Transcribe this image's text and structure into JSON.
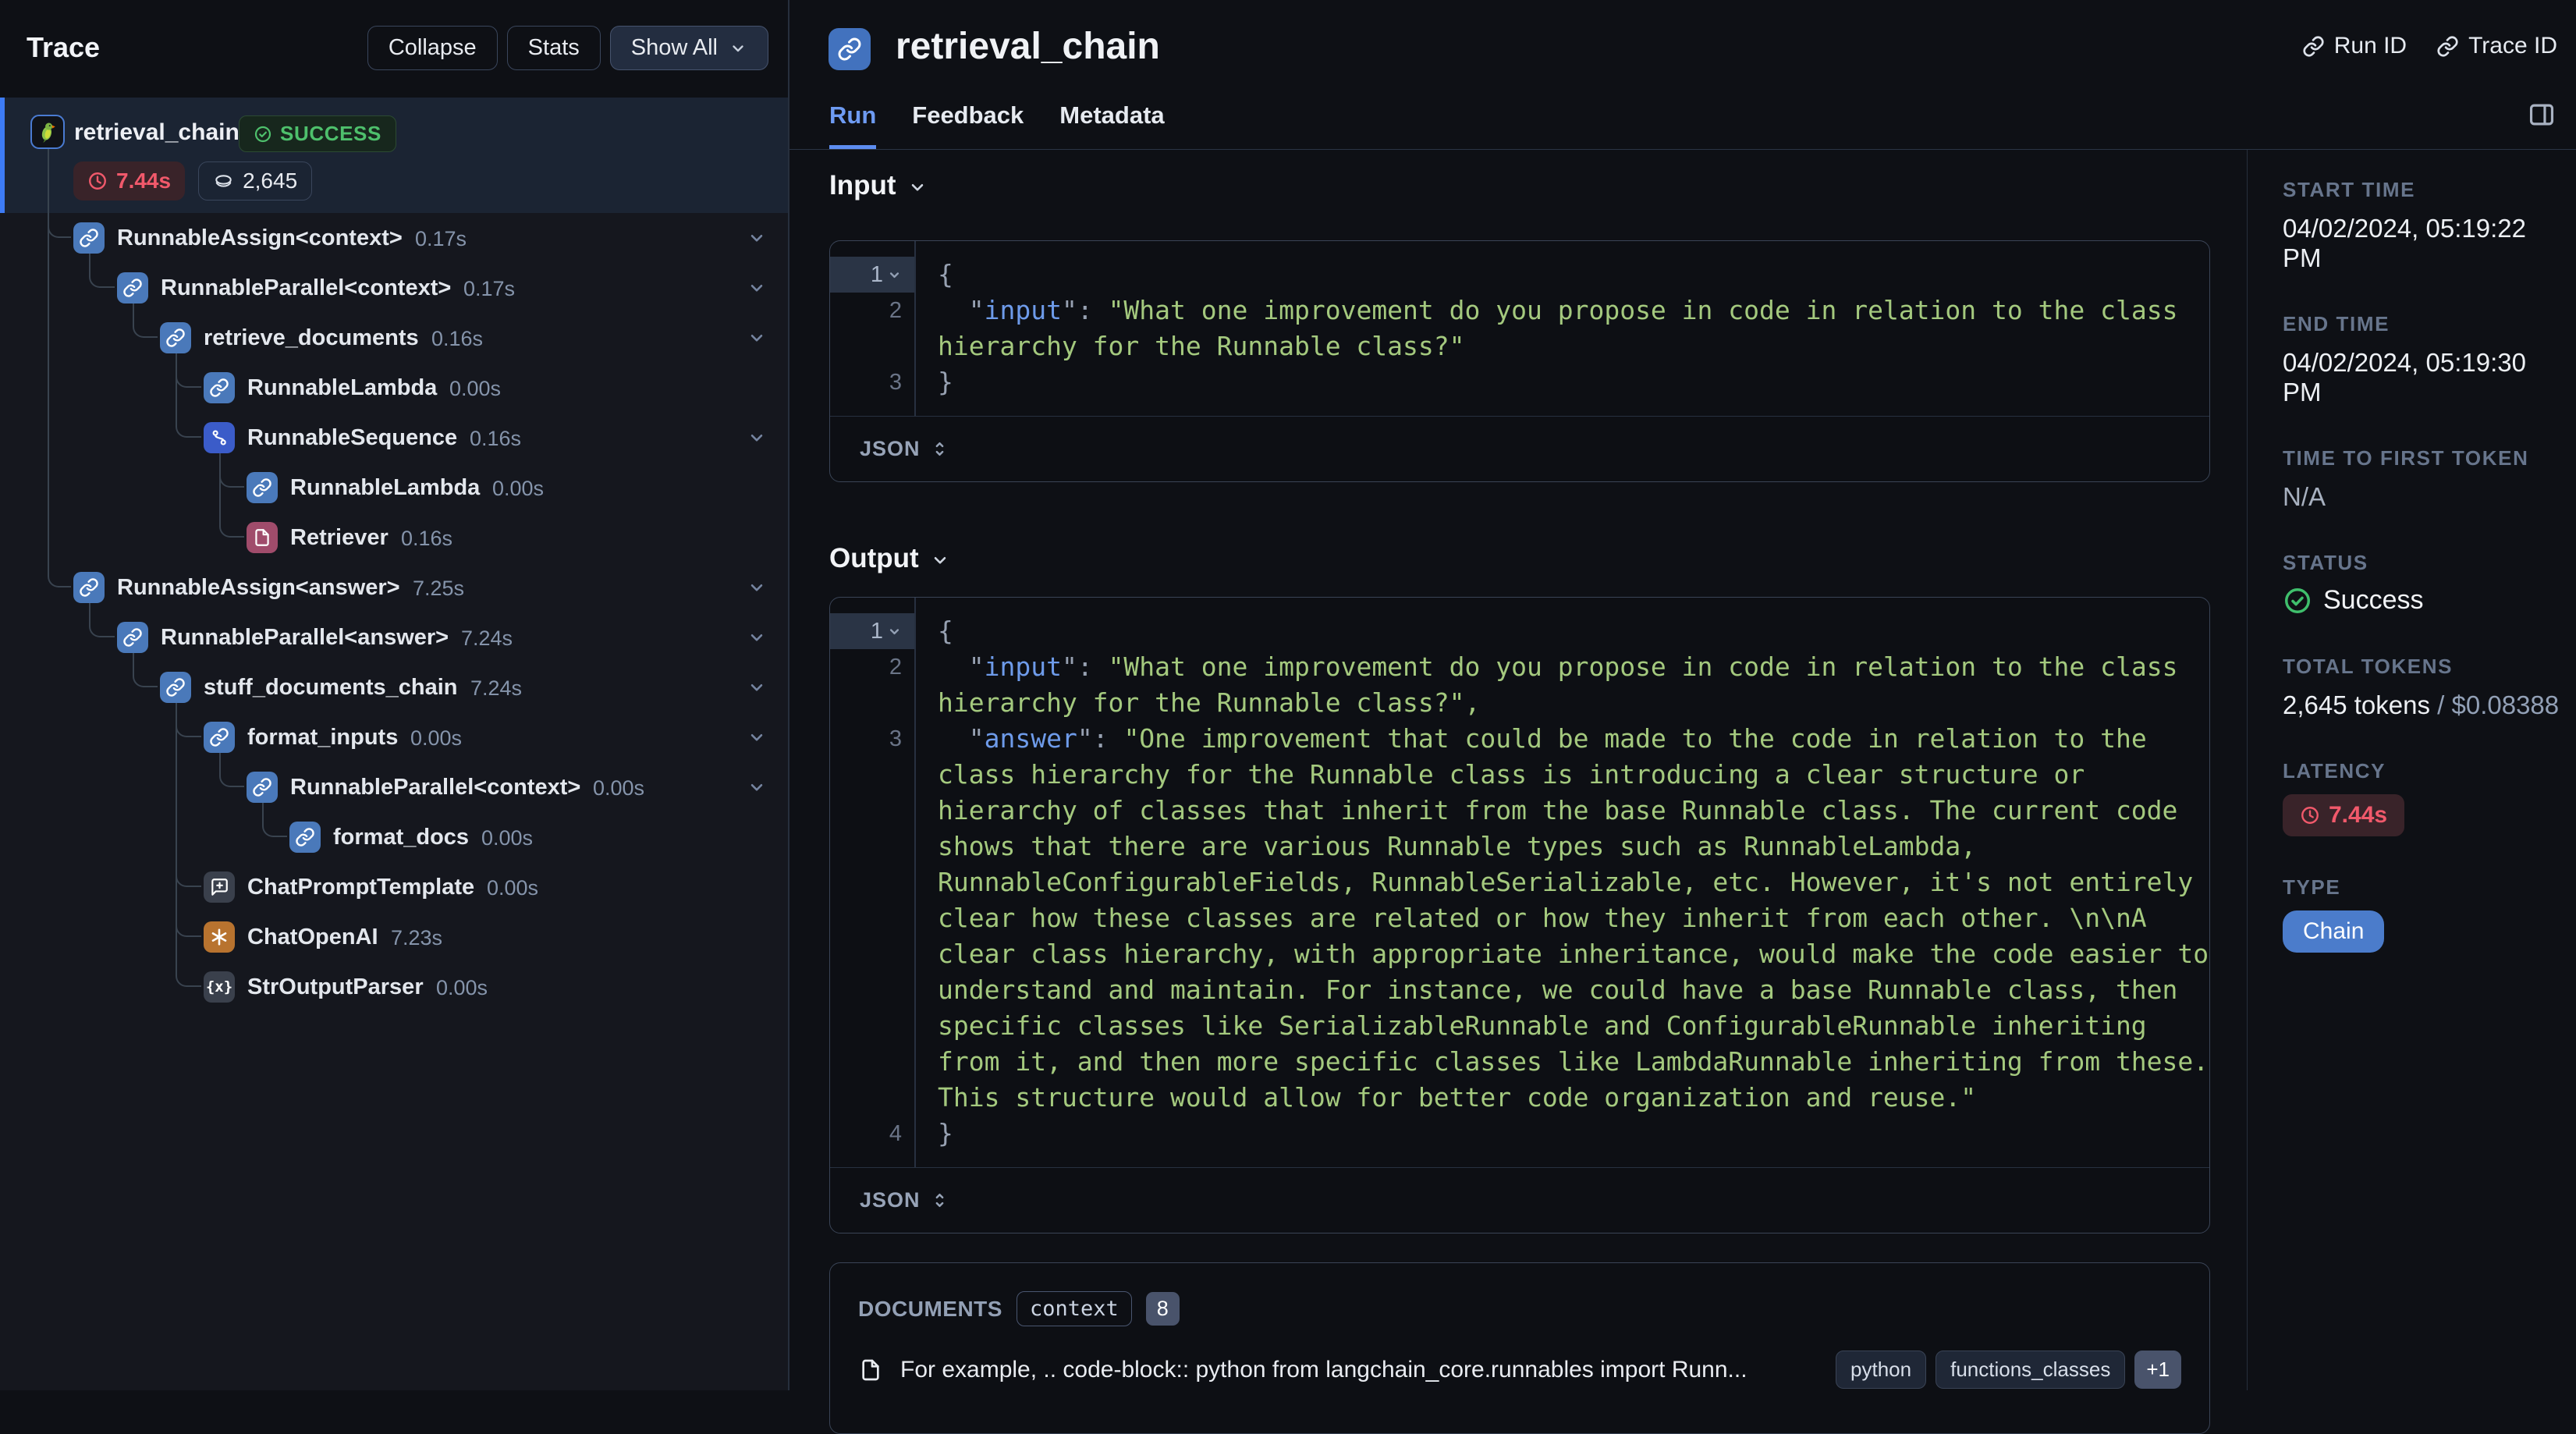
{
  "colors": {
    "accent_blue": "#3D7BF5",
    "success_green": "#4EC06C",
    "error_red": "#F1596B",
    "code_key_blue": "#6E9BEA",
    "code_string_green": "#A4C97E",
    "type_badge_blue": "#4B7CCB",
    "icon_chain_blue": "#4A79BA",
    "icon_sequence_blue": "#3B5CC9",
    "icon_retriever_maroon": "#A04C6B",
    "icon_openai_orange": "#B8732F"
  },
  "sidebar": {
    "title": "Trace",
    "buttons": {
      "collapse": "Collapse",
      "stats": "Stats",
      "show_all": "Show All"
    },
    "root": {
      "label": "retrieval_chain",
      "status": "SUCCESS",
      "latency": "7.44s",
      "tokens": "2,645"
    },
    "tree": [
      {
        "label": "RunnableAssign<context>",
        "duration": "0.17s",
        "depth": 1,
        "icon": "link",
        "expandable": true
      },
      {
        "label": "RunnableParallel<context>",
        "duration": "0.17s",
        "depth": 2,
        "icon": "link",
        "expandable": true
      },
      {
        "label": "retrieve_documents",
        "duration": "0.16s",
        "depth": 3,
        "icon": "link",
        "expandable": true
      },
      {
        "label": "RunnableLambda",
        "duration": "0.00s",
        "depth": 4,
        "icon": "link",
        "expandable": false
      },
      {
        "label": "RunnableSequence",
        "duration": "0.16s",
        "depth": 4,
        "icon": "sequence",
        "expandable": true
      },
      {
        "label": "RunnableLambda",
        "duration": "0.00s",
        "depth": 5,
        "icon": "link",
        "expandable": false
      },
      {
        "label": "Retriever",
        "duration": "0.16s",
        "depth": 5,
        "icon": "retriever",
        "expandable": false
      },
      {
        "label": "RunnableAssign<answer>",
        "duration": "7.25s",
        "depth": 1,
        "icon": "link",
        "expandable": true
      },
      {
        "label": "RunnableParallel<answer>",
        "duration": "7.24s",
        "depth": 2,
        "icon": "link",
        "expandable": true
      },
      {
        "label": "stuff_documents_chain",
        "duration": "7.24s",
        "depth": 3,
        "icon": "link",
        "expandable": true
      },
      {
        "label": "format_inputs",
        "duration": "0.00s",
        "depth": 4,
        "icon": "link",
        "expandable": true
      },
      {
        "label": "RunnableParallel<context>",
        "duration": "0.00s",
        "depth": 5,
        "icon": "link",
        "expandable": true
      },
      {
        "label": "format_docs",
        "duration": "0.00s",
        "depth": 6,
        "icon": "link",
        "expandable": false
      },
      {
        "label": "ChatPromptTemplate",
        "duration": "0.00s",
        "depth": 4,
        "icon": "prompt",
        "expandable": false
      },
      {
        "label": "ChatOpenAI",
        "duration": "7.23s",
        "depth": 4,
        "icon": "openai",
        "expandable": false
      },
      {
        "label": "StrOutputParser",
        "duration": "0.00s",
        "depth": 4,
        "icon": "parser",
        "expandable": false
      }
    ]
  },
  "header": {
    "title": "retrieval_chain",
    "run_id_label": "Run ID",
    "trace_id_label": "Trace ID",
    "tabs": [
      {
        "label": "Run",
        "active": true
      },
      {
        "label": "Feedback",
        "active": false
      },
      {
        "label": "Metadata",
        "active": false
      }
    ]
  },
  "run": {
    "input": {
      "heading": "Input",
      "format_label": "JSON",
      "rows": [
        {
          "n": "1",
          "h": true,
          "c": true,
          "s": [
            [
              "p",
              "{"
            ]
          ]
        },
        {
          "n": "2",
          "s": [
            [
              "p",
              "  \""
            ],
            [
              "k",
              "input"
            ],
            [
              "p",
              "\": "
            ],
            [
              "s",
              "\"What one improvement do you propose in code in relation to the class"
            ]
          ]
        },
        {
          "n": "",
          "s": [
            [
              "s",
              "hierarchy for the Runnable class?\""
            ]
          ]
        },
        {
          "n": "3",
          "s": [
            [
              "p",
              "}"
            ]
          ]
        }
      ]
    },
    "output": {
      "heading": "Output",
      "format_label": "JSON",
      "rows": [
        {
          "n": "1",
          "h": true,
          "c": true,
          "s": [
            [
              "p",
              "{"
            ]
          ]
        },
        {
          "n": "2",
          "s": [
            [
              "p",
              "  \""
            ],
            [
              "k",
              "input"
            ],
            [
              "p",
              "\": "
            ],
            [
              "s",
              "\"What one improvement do you propose in code in relation to the class"
            ]
          ]
        },
        {
          "n": "",
          "s": [
            [
              "s",
              "hierarchy for the Runnable class?\","
            ]
          ]
        },
        {
          "n": "3",
          "s": [
            [
              "p",
              "  \""
            ],
            [
              "k",
              "answer"
            ],
            [
              "p",
              "\": "
            ],
            [
              "s",
              "\"One improvement that could be made to the code in relation to the"
            ]
          ]
        },
        {
          "n": "",
          "s": [
            [
              "s",
              "class hierarchy for the Runnable class is introducing a clear structure or"
            ]
          ]
        },
        {
          "n": "",
          "s": [
            [
              "s",
              "hierarchy of classes that inherit from the base Runnable class. The current code"
            ]
          ]
        },
        {
          "n": "",
          "s": [
            [
              "s",
              "shows that there are various Runnable types such as RunnableLambda,"
            ]
          ]
        },
        {
          "n": "",
          "s": [
            [
              "s",
              "RunnableConfigurableFields, RunnableSerializable, etc. However, it's not entirely"
            ]
          ]
        },
        {
          "n": "",
          "s": [
            [
              "s",
              "clear how these classes are related or how they inherit from each other. \\n\\nA"
            ]
          ]
        },
        {
          "n": "",
          "s": [
            [
              "s",
              "clear class hierarchy, with appropriate inheritance, would make the code easier to"
            ]
          ]
        },
        {
          "n": "",
          "s": [
            [
              "s",
              "understand and maintain. For instance, we could have a base Runnable class, then"
            ]
          ]
        },
        {
          "n": "",
          "s": [
            [
              "s",
              "specific classes like SerializableRunnable and ConfigurableRunnable inheriting"
            ]
          ]
        },
        {
          "n": "",
          "s": [
            [
              "s",
              "from it, and then more specific classes like LambdaRunnable inheriting from these."
            ]
          ]
        },
        {
          "n": "",
          "s": [
            [
              "s",
              "This structure would allow for better code organization and reuse.\""
            ]
          ]
        },
        {
          "n": "4",
          "s": [
            [
              "p",
              "}"
            ]
          ]
        }
      ]
    },
    "documents": {
      "heading": "DOCUMENTS",
      "key": "context",
      "count": "8",
      "items": [
        {
          "text": "For example, .. code-block:: python from langchain_core.runnables import Runn...",
          "tags": [
            "python",
            "functions_classes"
          ],
          "more": "+1"
        }
      ]
    }
  },
  "meta": {
    "start_time": {
      "label": "START TIME",
      "value": "04/02/2024, 05:19:22 PM"
    },
    "end_time": {
      "label": "END TIME",
      "value": "04/02/2024, 05:19:30 PM"
    },
    "ttft": {
      "label": "TIME TO FIRST TOKEN",
      "value": "N/A"
    },
    "status": {
      "label": "STATUS",
      "value": "Success"
    },
    "total_tokens": {
      "label": "TOTAL TOKENS",
      "value": "2,645 tokens",
      "cost_suffix": " / $0.08388"
    },
    "latency": {
      "label": "LATENCY",
      "value": "7.44s"
    },
    "type": {
      "label": "TYPE",
      "value": "Chain"
    }
  }
}
